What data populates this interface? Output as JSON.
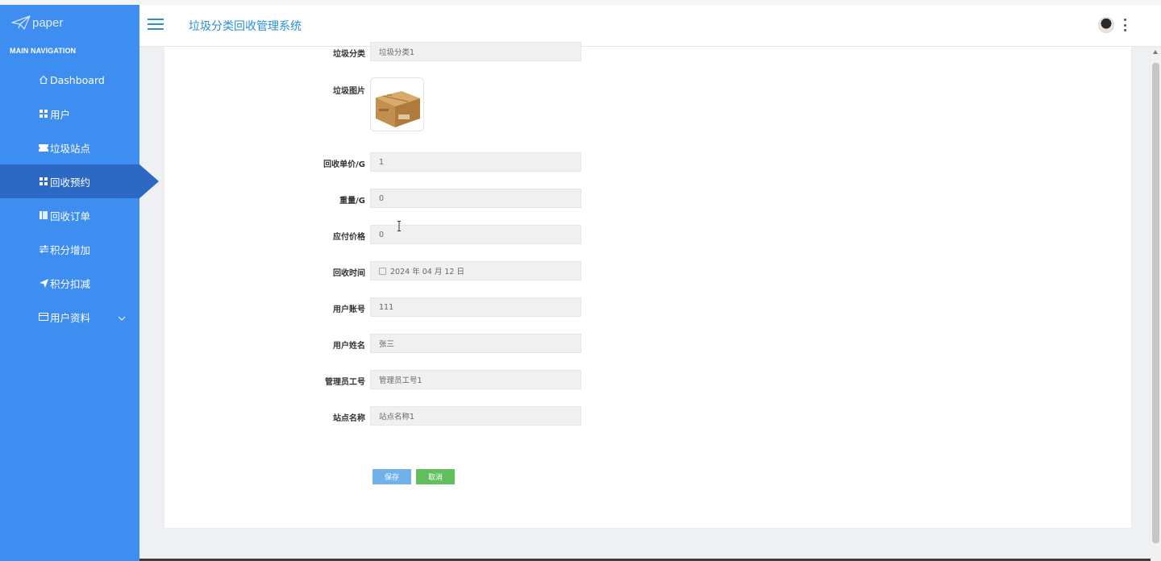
{
  "sidebar": {
    "logo_text": "paper",
    "nav_heading": "MAIN NAVIGATION",
    "items": [
      {
        "label": "Dashboard",
        "icon": "home-icon"
      },
      {
        "label": "用户",
        "icon": "grid-icon"
      },
      {
        "label": "垃圾站点",
        "icon": "ticket-icon"
      },
      {
        "label": "回收预约",
        "icon": "grid-icon",
        "active": true
      },
      {
        "label": "回收订单",
        "icon": "columns-icon"
      },
      {
        "label": "积分增加",
        "icon": "sliders-icon"
      },
      {
        "label": "积分扣减",
        "icon": "send-icon"
      },
      {
        "label": "用户资料",
        "icon": "card-icon",
        "has_submenu": true
      }
    ],
    "colors": {
      "background": "#3e8df0",
      "active": "#2c69c4"
    }
  },
  "header": {
    "title": "垃圾分类回收管理系统",
    "accent": "#2d8fd5"
  },
  "form": {
    "fields": [
      {
        "label": "垃圾分类",
        "value": "垃圾分类1"
      },
      {
        "label": "垃圾图片",
        "type": "image",
        "image": "cardboard-box"
      },
      {
        "label": "回收单价/G",
        "value": "1"
      },
      {
        "label": "重量/G",
        "value": "0"
      },
      {
        "label": "应付价格",
        "value": "0"
      },
      {
        "label": "回收时间",
        "value": "2024 年 04 月 12 日",
        "type": "date"
      },
      {
        "label": "用户账号",
        "value": "111"
      },
      {
        "label": "用户姓名",
        "value": "张三"
      },
      {
        "label": "管理员工号",
        "value": "管理员工号1"
      },
      {
        "label": "站点名称",
        "value": "站点名称1"
      }
    ],
    "buttons": {
      "save": "保存",
      "cancel": "取消"
    },
    "button_colors": {
      "save": "#6fb1ea",
      "cancel": "#61c05d"
    }
  }
}
